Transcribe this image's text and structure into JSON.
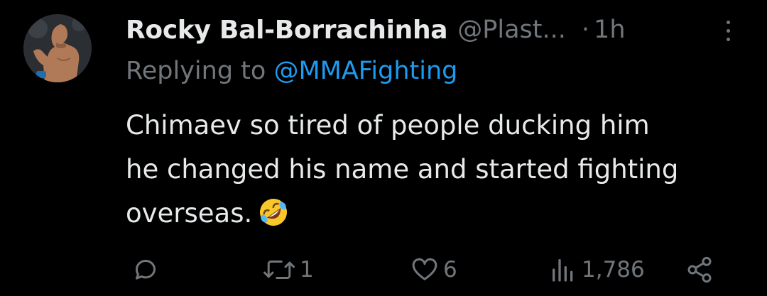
{
  "tweet": {
    "author_name": "Rocky Bal-Borrachinha",
    "handle": "@Plast...",
    "separator": "·",
    "time": "1h",
    "replying_prefix": "Replying to",
    "replying_to": "@MMAFighting",
    "text_lines": [
      "Chimaev so tired of people ducking him",
      "he changed his name and started fighting",
      "overseas."
    ],
    "emoji": "rolling-on-floor-laughing-emoji"
  },
  "actions": {
    "reply_icon": "reply-icon",
    "retweet_icon": "retweet-icon",
    "retweet_count": "1",
    "like_icon": "heart-icon",
    "like_count": "6",
    "views_icon": "views-icon",
    "views_count": "1,786",
    "share_icon": "share-icon"
  },
  "colors": {
    "background": "#000000",
    "text": "#e7e9ea",
    "secondary": "#71767b",
    "link": "#1d9bf0"
  }
}
